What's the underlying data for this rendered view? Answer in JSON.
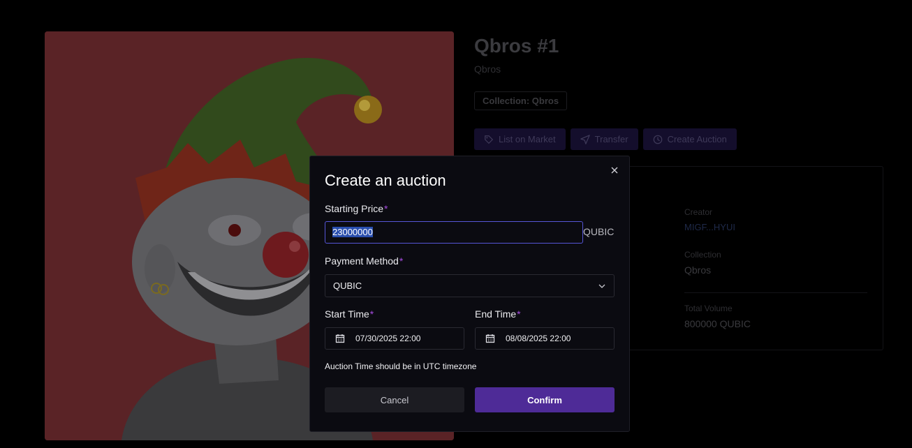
{
  "nft": {
    "title": "Qbros #1",
    "subtitle": "Qbros",
    "collection_tag": "Collection: Qbros",
    "image_icon": "jester-nft-artwork"
  },
  "actions": {
    "list_on_market": "List on Market",
    "transfer": "Transfer",
    "create_auction": "Create Auction"
  },
  "details": {
    "creator_label": "Creator",
    "creator_value": "MIGF...HYUI",
    "collection_label": "Collection",
    "collection_value": "Qbros",
    "total_volume_label": "Total Volume",
    "total_volume_value": "800000 QUBIC"
  },
  "modal": {
    "title": "Create an auction",
    "required_mark": "*",
    "starting_price_label": "Starting Price",
    "starting_price_value": "23000000",
    "price_unit": "QUBIC",
    "payment_method_label": "Payment Method",
    "payment_method_value": "QUBIC",
    "start_time_label": "Start Time",
    "start_time_value": "07/30/2025 22:00",
    "end_time_label": "End Time",
    "end_time_value": "08/08/2025 22:00",
    "note": "Auction Time should be in UTC timezone",
    "cancel_label": "Cancel",
    "confirm_label": "Confirm"
  },
  "colors": {
    "accent": "#4e2b97",
    "focus_border": "#5656d8",
    "required_mark": "#a64ce0",
    "image_background": "#5a2326"
  }
}
